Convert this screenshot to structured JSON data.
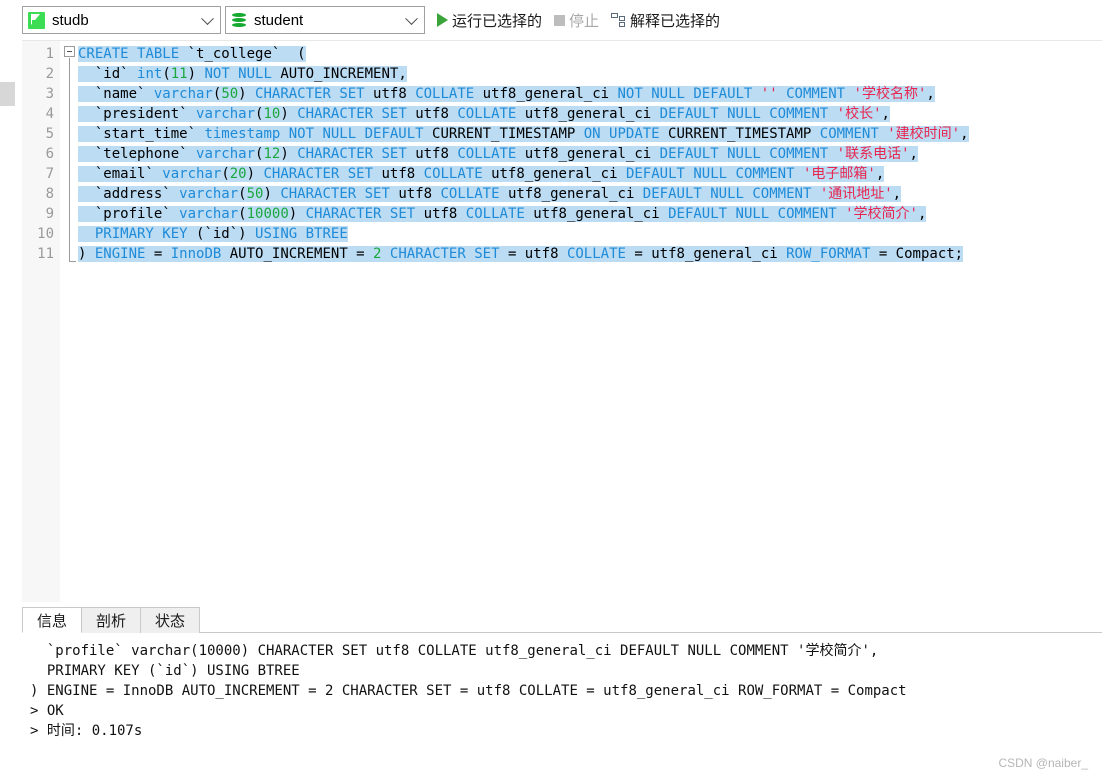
{
  "toolbar": {
    "connection": {
      "icon": "mysql-connection-icon",
      "value": "studb"
    },
    "schema": {
      "icon": "database-icon",
      "value": "student"
    },
    "run_selected": {
      "icon": "play-icon",
      "label": "运行已选择的"
    },
    "stop": {
      "icon": "stop-icon",
      "label": "停止"
    },
    "explain_selected": {
      "icon": "explain-icon",
      "label": "解释已选择的"
    }
  },
  "editor": {
    "line_numbers": [
      "1",
      "2",
      "3",
      "4",
      "5",
      "6",
      "7",
      "8",
      "9",
      "10",
      "11"
    ],
    "lines": [
      {
        "n": "1",
        "tokens": [
          {
            "t": "CREATE ",
            "c": "kw"
          },
          {
            "t": "TABLE ",
            "c": "kw"
          },
          {
            "t": "`t_college`  (",
            "c": "pln"
          }
        ]
      },
      {
        "n": "2",
        "tokens": [
          {
            "t": "  `id` ",
            "c": "pln"
          },
          {
            "t": "int",
            "c": "kw"
          },
          {
            "t": "(",
            "c": "pln"
          },
          {
            "t": "11",
            "c": "num"
          },
          {
            "t": ") ",
            "c": "pln"
          },
          {
            "t": "NOT NULL ",
            "c": "kw"
          },
          {
            "t": "AUTO_INCREMENT,",
            "c": "pln"
          }
        ]
      },
      {
        "n": "3",
        "tokens": [
          {
            "t": "  `name` ",
            "c": "pln"
          },
          {
            "t": "varchar",
            "c": "kw"
          },
          {
            "t": "(",
            "c": "pln"
          },
          {
            "t": "50",
            "c": "num"
          },
          {
            "t": ") ",
            "c": "pln"
          },
          {
            "t": "CHARACTER SET ",
            "c": "kw"
          },
          {
            "t": "utf8 ",
            "c": "pln"
          },
          {
            "t": "COLLATE ",
            "c": "kw"
          },
          {
            "t": "utf8_general_ci ",
            "c": "pln"
          },
          {
            "t": "NOT NULL DEFAULT ",
            "c": "kw"
          },
          {
            "t": "'' ",
            "c": "str"
          },
          {
            "t": "COMMENT ",
            "c": "kw"
          },
          {
            "t": "'学校名称'",
            "c": "str"
          },
          {
            "t": ",",
            "c": "pln"
          }
        ]
      },
      {
        "n": "4",
        "tokens": [
          {
            "t": "  `president` ",
            "c": "pln"
          },
          {
            "t": "varchar",
            "c": "kw"
          },
          {
            "t": "(",
            "c": "pln"
          },
          {
            "t": "10",
            "c": "num"
          },
          {
            "t": ") ",
            "c": "pln"
          },
          {
            "t": "CHARACTER SET ",
            "c": "kw"
          },
          {
            "t": "utf8 ",
            "c": "pln"
          },
          {
            "t": "COLLATE ",
            "c": "kw"
          },
          {
            "t": "utf8_general_ci ",
            "c": "pln"
          },
          {
            "t": "DEFAULT NULL ",
            "c": "kw"
          },
          {
            "t": "COMMENT ",
            "c": "kw"
          },
          {
            "t": "'校长'",
            "c": "str"
          },
          {
            "t": ",",
            "c": "pln"
          }
        ]
      },
      {
        "n": "5",
        "tokens": [
          {
            "t": "  `start_time` ",
            "c": "pln"
          },
          {
            "t": "timestamp ",
            "c": "kw"
          },
          {
            "t": "NOT NULL DEFAULT ",
            "c": "kw"
          },
          {
            "t": "CURRENT_TIMESTAMP ",
            "c": "pln"
          },
          {
            "t": "ON UPDATE ",
            "c": "kw"
          },
          {
            "t": "CURRENT_TIMESTAMP ",
            "c": "pln"
          },
          {
            "t": "COMMENT ",
            "c": "kw"
          },
          {
            "t": "'建校时间'",
            "c": "str"
          },
          {
            "t": ",",
            "c": "pln"
          }
        ]
      },
      {
        "n": "6",
        "tokens": [
          {
            "t": "  `telephone` ",
            "c": "pln"
          },
          {
            "t": "varchar",
            "c": "kw"
          },
          {
            "t": "(",
            "c": "pln"
          },
          {
            "t": "12",
            "c": "num"
          },
          {
            "t": ") ",
            "c": "pln"
          },
          {
            "t": "CHARACTER SET ",
            "c": "kw"
          },
          {
            "t": "utf8 ",
            "c": "pln"
          },
          {
            "t": "COLLATE ",
            "c": "kw"
          },
          {
            "t": "utf8_general_ci ",
            "c": "pln"
          },
          {
            "t": "DEFAULT NULL ",
            "c": "kw"
          },
          {
            "t": "COMMENT ",
            "c": "kw"
          },
          {
            "t": "'联系电话'",
            "c": "str"
          },
          {
            "t": ",",
            "c": "pln"
          }
        ]
      },
      {
        "n": "7",
        "tokens": [
          {
            "t": "  `email` ",
            "c": "pln"
          },
          {
            "t": "varchar",
            "c": "kw"
          },
          {
            "t": "(",
            "c": "pln"
          },
          {
            "t": "20",
            "c": "num"
          },
          {
            "t": ") ",
            "c": "pln"
          },
          {
            "t": "CHARACTER SET ",
            "c": "kw"
          },
          {
            "t": "utf8 ",
            "c": "pln"
          },
          {
            "t": "COLLATE ",
            "c": "kw"
          },
          {
            "t": "utf8_general_ci ",
            "c": "pln"
          },
          {
            "t": "DEFAULT NULL ",
            "c": "kw"
          },
          {
            "t": "COMMENT ",
            "c": "kw"
          },
          {
            "t": "'电子邮箱'",
            "c": "str"
          },
          {
            "t": ",",
            "c": "pln"
          }
        ]
      },
      {
        "n": "8",
        "tokens": [
          {
            "t": "  `address` ",
            "c": "pln"
          },
          {
            "t": "varchar",
            "c": "kw"
          },
          {
            "t": "(",
            "c": "pln"
          },
          {
            "t": "50",
            "c": "num"
          },
          {
            "t": ") ",
            "c": "pln"
          },
          {
            "t": "CHARACTER SET ",
            "c": "kw"
          },
          {
            "t": "utf8 ",
            "c": "pln"
          },
          {
            "t": "COLLATE ",
            "c": "kw"
          },
          {
            "t": "utf8_general_ci ",
            "c": "pln"
          },
          {
            "t": "DEFAULT NULL ",
            "c": "kw"
          },
          {
            "t": "COMMENT ",
            "c": "kw"
          },
          {
            "t": "'通讯地址'",
            "c": "str"
          },
          {
            "t": ",",
            "c": "pln"
          }
        ]
      },
      {
        "n": "9",
        "tokens": [
          {
            "t": "  `profile` ",
            "c": "pln"
          },
          {
            "t": "varchar",
            "c": "kw"
          },
          {
            "t": "(",
            "c": "pln"
          },
          {
            "t": "10000",
            "c": "num"
          },
          {
            "t": ") ",
            "c": "pln"
          },
          {
            "t": "CHARACTER SET ",
            "c": "kw"
          },
          {
            "t": "utf8 ",
            "c": "pln"
          },
          {
            "t": "COLLATE ",
            "c": "kw"
          },
          {
            "t": "utf8_general_ci ",
            "c": "pln"
          },
          {
            "t": "DEFAULT NULL ",
            "c": "kw"
          },
          {
            "t": "COMMENT ",
            "c": "kw"
          },
          {
            "t": "'学校简介'",
            "c": "str"
          },
          {
            "t": ",",
            "c": "pln"
          }
        ]
      },
      {
        "n": "10",
        "tokens": [
          {
            "t": "  PRIMARY KEY ",
            "c": "kw"
          },
          {
            "t": "(`id`) ",
            "c": "pln"
          },
          {
            "t": "USING ",
            "c": "kw"
          },
          {
            "t": "BTREE",
            "c": "kw"
          }
        ]
      },
      {
        "n": "11",
        "tokens": [
          {
            "t": ") ",
            "c": "pln"
          },
          {
            "t": "ENGINE ",
            "c": "kw"
          },
          {
            "t": "= ",
            "c": "pln"
          },
          {
            "t": "InnoDB ",
            "c": "kw"
          },
          {
            "t": "AUTO_INCREMENT = ",
            "c": "pln"
          },
          {
            "t": "2",
            "c": "num"
          },
          {
            "t": " ",
            "c": "pln"
          },
          {
            "t": "CHARACTER SET ",
            "c": "kw"
          },
          {
            "t": "= utf8 ",
            "c": "pln"
          },
          {
            "t": "COLLATE ",
            "c": "kw"
          },
          {
            "t": "= utf8_general_ci ",
            "c": "pln"
          },
          {
            "t": "ROW_FORMAT ",
            "c": "kw"
          },
          {
            "t": "= Compact;",
            "c": "pln"
          }
        ]
      }
    ]
  },
  "bottom_panel": {
    "tabs": [
      {
        "label": "信息",
        "active": true
      },
      {
        "label": "剖析",
        "active": false
      },
      {
        "label": "状态",
        "active": false
      }
    ],
    "output_lines": [
      "  `profile` varchar(10000) CHARACTER SET utf8 COLLATE utf8_general_ci DEFAULT NULL COMMENT '学校简介',",
      "  PRIMARY KEY (`id`) USING BTREE",
      ") ENGINE = InnoDB AUTO_INCREMENT = 2 CHARACTER SET = utf8 COLLATE = utf8_general_ci ROW_FORMAT = Compact",
      "> OK",
      "> 时间: 0.107s"
    ]
  },
  "watermark": "CSDN @naiber_",
  "colors": {
    "keyword": "#1e8bd8",
    "number": "#1aa83c",
    "string": "#e8254f",
    "selection": "#bcdcf4",
    "gutter_bg": "#f7f7f7",
    "accent_green": "#3aa33a"
  }
}
